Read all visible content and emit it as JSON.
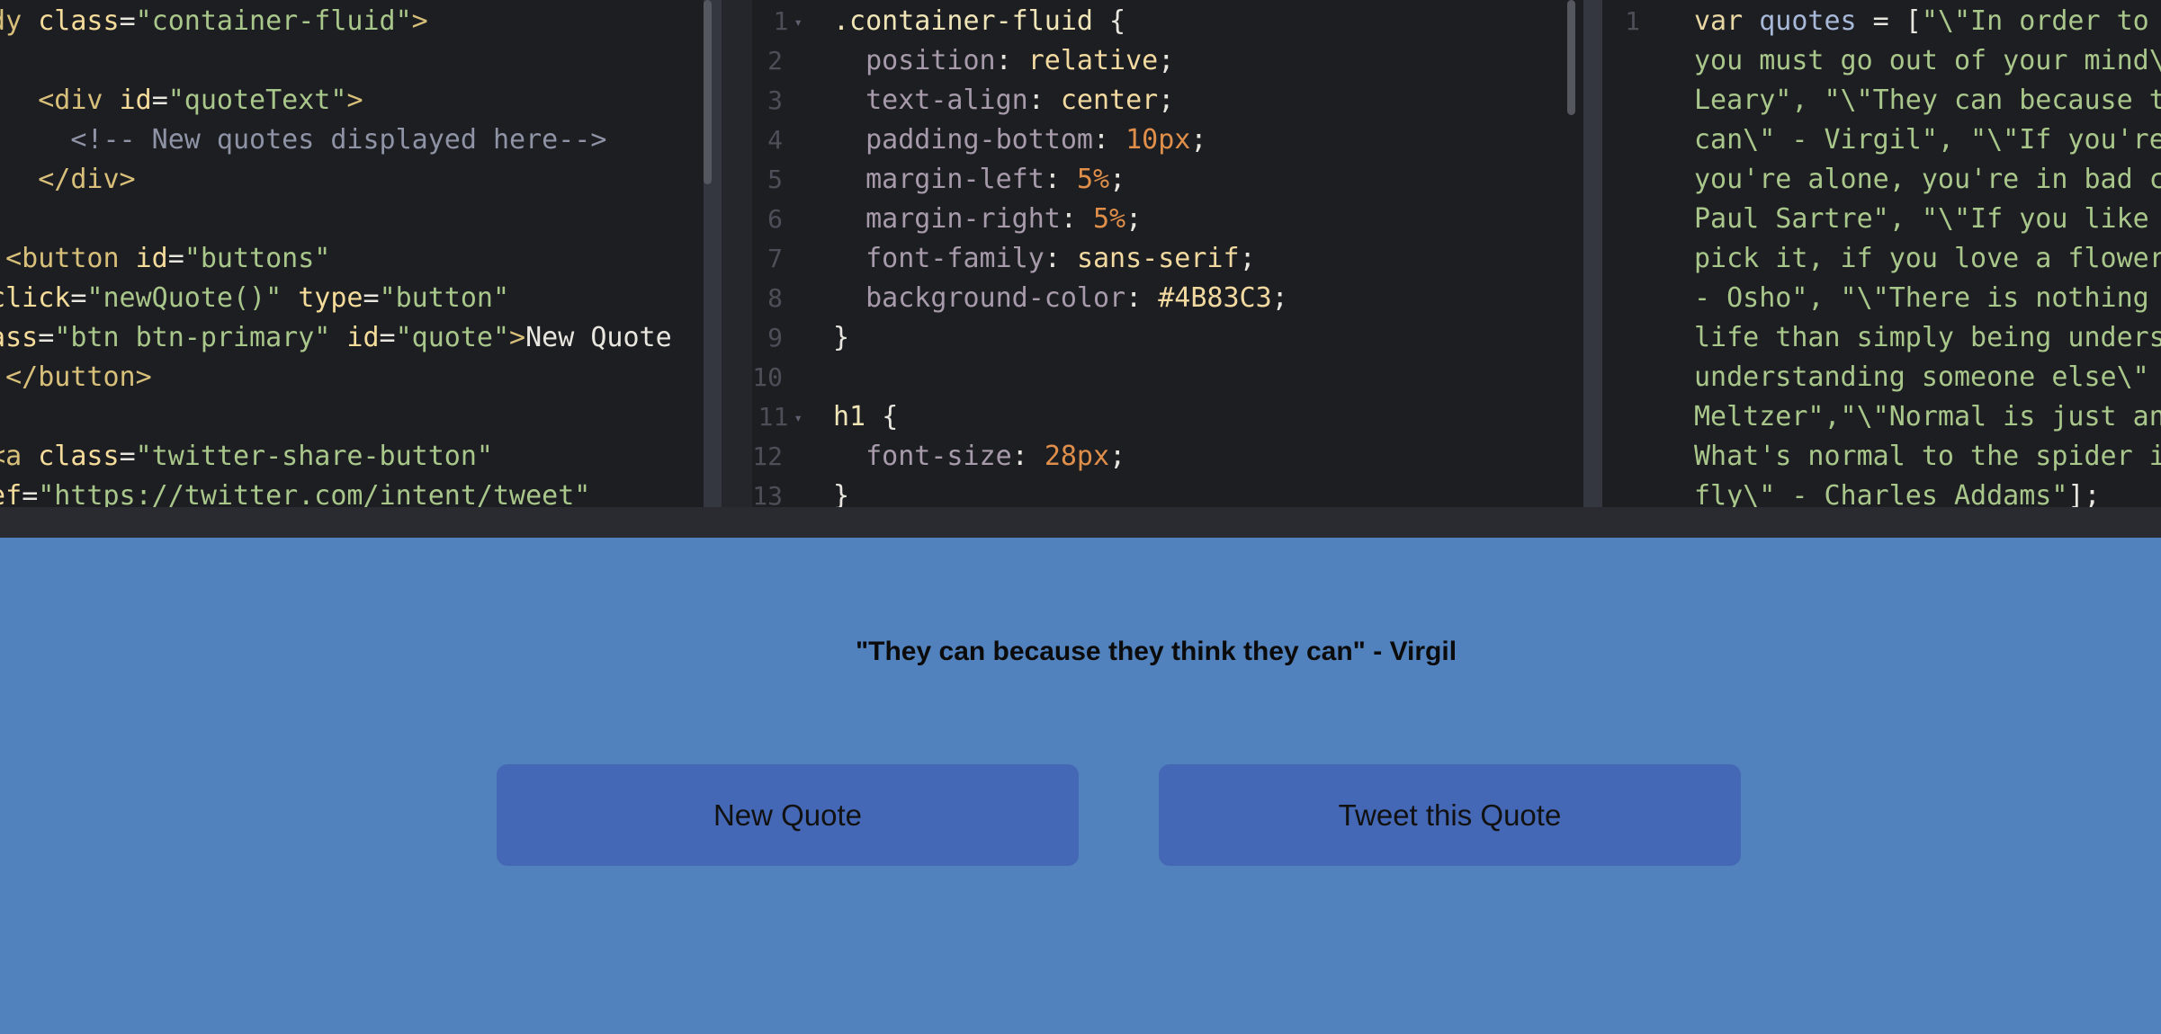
{
  "html_editor": {
    "lines": [
      [
        [
          "t-tag",
          "ody "
        ],
        [
          "t-attr",
          "class"
        ],
        [
          "t-plain",
          "="
        ],
        [
          "t-str",
          "\"container-fluid\""
        ],
        [
          "t-tag",
          ">"
        ]
      ],
      [],
      [
        [
          "t-plain",
          "    "
        ],
        [
          "t-tag",
          "<div "
        ],
        [
          "t-attr",
          "id"
        ],
        [
          "t-plain",
          "="
        ],
        [
          "t-str",
          "\"quoteText\""
        ],
        [
          "t-tag",
          ">"
        ]
      ],
      [
        [
          "t-plain",
          "      "
        ],
        [
          "t-com",
          "<!-- New quotes displayed here-->"
        ]
      ],
      [
        [
          "t-plain",
          "    "
        ],
        [
          "t-tag",
          "</div>"
        ]
      ],
      [],
      [
        [
          "t-plain",
          "  "
        ],
        [
          "t-tag",
          "<button "
        ],
        [
          "t-attr",
          "id"
        ],
        [
          "t-plain",
          "="
        ],
        [
          "t-str",
          "\"buttons\""
        ]
      ],
      [
        [
          "t-attr",
          "nclick"
        ],
        [
          "t-plain",
          "="
        ],
        [
          "t-str",
          "\"newQuote()\" "
        ],
        [
          "t-attr",
          "type"
        ],
        [
          "t-plain",
          "="
        ],
        [
          "t-str",
          "\"button\""
        ]
      ],
      [
        [
          "t-attr",
          "lass"
        ],
        [
          "t-plain",
          "="
        ],
        [
          "t-str",
          "\"btn btn-primary\" "
        ],
        [
          "t-attr",
          "id"
        ],
        [
          "t-plain",
          "="
        ],
        [
          "t-str",
          "\"quote\""
        ],
        [
          "t-tag",
          ">"
        ],
        [
          "t-plain",
          "New Quote"
        ]
      ],
      [
        [
          "t-plain",
          "  "
        ],
        [
          "t-tag",
          "</button>"
        ]
      ],
      [],
      [
        [
          "t-plain",
          " "
        ],
        [
          "t-tag",
          "<a "
        ],
        [
          "t-attr",
          "class"
        ],
        [
          "t-plain",
          "="
        ],
        [
          "t-str",
          "\"twitter-share-button\""
        ]
      ],
      [
        [
          "t-attr",
          "ref"
        ],
        [
          "t-plain",
          "="
        ],
        [
          "t-str",
          "\"https://twitter.com/intent/tweet\""
        ]
      ]
    ]
  },
  "css_editor": {
    "line_numbers": [
      "1",
      "2",
      "3",
      "4",
      "5",
      "6",
      "7",
      "8",
      "9",
      "10",
      "11",
      "12",
      "13"
    ],
    "fold_lines": [
      1,
      11
    ],
    "lines": [
      [
        [
          "t-sel",
          ".container-fluid "
        ],
        [
          "t-plain",
          "{"
        ]
      ],
      [
        [
          "t-plain",
          "  "
        ],
        [
          "t-prop",
          "position"
        ],
        [
          "t-plain",
          ": "
        ],
        [
          "t-val",
          "relative"
        ],
        [
          "t-plain",
          ";"
        ]
      ],
      [
        [
          "t-plain",
          "  "
        ],
        [
          "t-prop",
          "text-align"
        ],
        [
          "t-plain",
          ": "
        ],
        [
          "t-val",
          "center"
        ],
        [
          "t-plain",
          ";"
        ]
      ],
      [
        [
          "t-plain",
          "  "
        ],
        [
          "t-prop",
          "padding-bottom"
        ],
        [
          "t-plain",
          ": "
        ],
        [
          "t-num",
          "10px"
        ],
        [
          "t-plain",
          ";"
        ]
      ],
      [
        [
          "t-plain",
          "  "
        ],
        [
          "t-prop",
          "margin-left"
        ],
        [
          "t-plain",
          ": "
        ],
        [
          "t-num",
          "5%"
        ],
        [
          "t-plain",
          ";"
        ]
      ],
      [
        [
          "t-plain",
          "  "
        ],
        [
          "t-prop",
          "margin-right"
        ],
        [
          "t-plain",
          ": "
        ],
        [
          "t-num",
          "5%"
        ],
        [
          "t-plain",
          ";"
        ]
      ],
      [
        [
          "t-plain",
          "  "
        ],
        [
          "t-prop",
          "font-family"
        ],
        [
          "t-plain",
          ": "
        ],
        [
          "t-val",
          "sans-serif"
        ],
        [
          "t-plain",
          ";"
        ]
      ],
      [
        [
          "t-plain",
          "  "
        ],
        [
          "t-prop",
          "background-color"
        ],
        [
          "t-plain",
          ": "
        ],
        [
          "t-val",
          "#4B83C3"
        ],
        [
          "t-plain",
          ";"
        ]
      ],
      [
        [
          "t-plain",
          "}"
        ]
      ],
      [],
      [
        [
          "t-sel",
          "h1 "
        ],
        [
          "t-plain",
          "{"
        ]
      ],
      [
        [
          "t-plain",
          "  "
        ],
        [
          "t-prop",
          "font-size"
        ],
        [
          "t-plain",
          ": "
        ],
        [
          "t-num",
          "28px"
        ],
        [
          "t-plain",
          ";"
        ]
      ],
      [
        [
          "t-plain",
          "}"
        ]
      ]
    ]
  },
  "js_editor": {
    "line_numbers": [
      "1",
      "",
      "",
      "",
      "",
      "",
      "",
      "",
      "",
      "",
      "",
      "",
      ""
    ],
    "lines": [
      [
        [
          "t-kw",
          "var "
        ],
        [
          "t-var",
          "quotes"
        ],
        [
          "t-plain",
          " = ["
        ],
        [
          "t-str",
          "\"\\\"In order to"
        ]
      ],
      [
        [
          "t-str",
          "you must go out of your mind\\"
        ]
      ],
      [
        [
          "t-str",
          "Leary\", \"\\\"They can because t"
        ]
      ],
      [
        [
          "t-str",
          "can\\\" - Virgil\", \"\\\"If you're"
        ]
      ],
      [
        [
          "t-str",
          "you're alone, you're in bad c"
        ]
      ],
      [
        [
          "t-str",
          "Paul Sartre\", \"\\\"If you like "
        ]
      ],
      [
        [
          "t-str",
          "pick it, if you love a flower"
        ]
      ],
      [
        [
          "t-str",
          "- Osho\", \"\\\"There is nothing "
        ]
      ],
      [
        [
          "t-str",
          "life than simply being unders"
        ]
      ],
      [
        [
          "t-str",
          "understanding someone else\\\" "
        ]
      ],
      [
        [
          "t-str",
          "Meltzer\",\"\\\"Normal is just an"
        ]
      ],
      [
        [
          "t-str",
          "What's normal to the spider i"
        ]
      ],
      [
        [
          "t-str",
          "fly\\\" - Charles Addams\""
        ],
        [
          "t-plain",
          "];"
        ]
      ]
    ]
  },
  "preview": {
    "quote": "\"They can because they think they can\" - Virgil",
    "new_quote_label": "New Quote",
    "tweet_label": "Tweet this Quote"
  }
}
